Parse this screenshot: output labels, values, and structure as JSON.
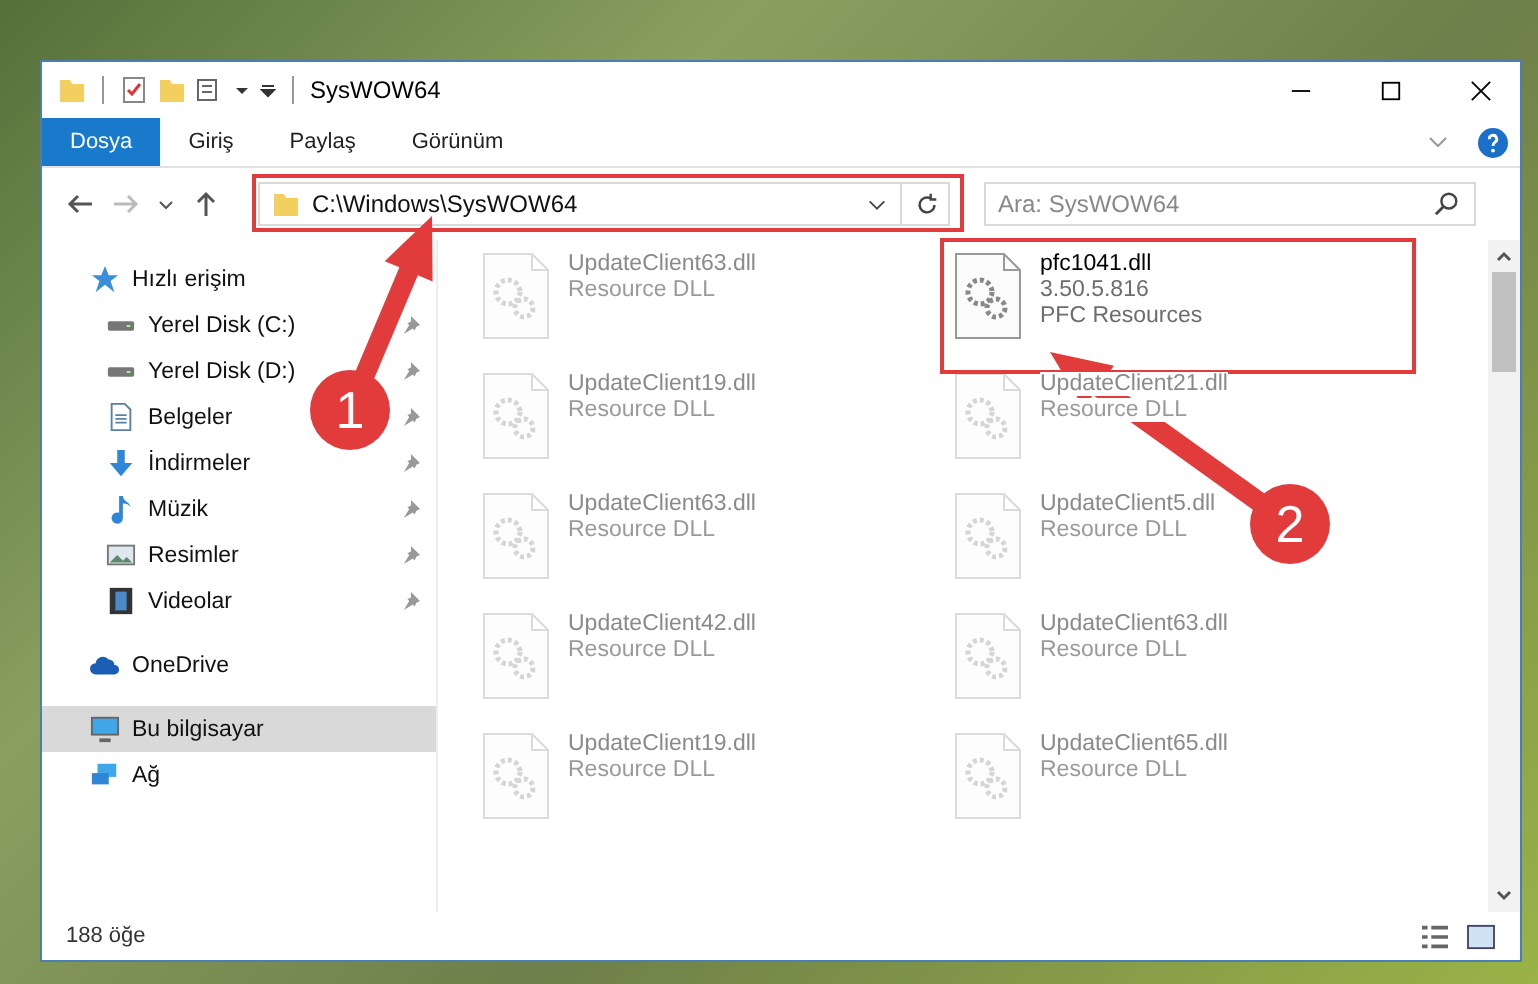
{
  "window": {
    "title": "SysWOW64"
  },
  "ribbon_tabs": [
    {
      "label": "Dosya",
      "selected": true
    },
    {
      "label": "Giriş",
      "selected": false
    },
    {
      "label": "Paylaş",
      "selected": false
    },
    {
      "label": "Görünüm",
      "selected": false
    }
  ],
  "address_bar": {
    "path": "C:\\Windows\\SysWOW64"
  },
  "search": {
    "placeholder": "Ara: SysWOW64"
  },
  "sidebar": {
    "items": [
      {
        "label": "Hızlı erişim",
        "kind": "star",
        "selected": false,
        "children": [
          {
            "label": "Yerel Disk (C:)",
            "kind": "drive",
            "selected": false
          },
          {
            "label": "Yerel Disk (D:)",
            "kind": "drive",
            "selected": false
          },
          {
            "label": "Belgeler",
            "kind": "document",
            "selected": false
          },
          {
            "label": "İndirmeler",
            "kind": "download",
            "selected": false
          },
          {
            "label": "Müzik",
            "kind": "music",
            "selected": false
          },
          {
            "label": "Resimler",
            "kind": "picture",
            "selected": false
          },
          {
            "label": "Videolar",
            "kind": "video",
            "selected": false
          }
        ]
      },
      {
        "label": "OneDrive",
        "kind": "cloud",
        "selected": false
      },
      {
        "label": "Bu bilgisayar",
        "kind": "computer",
        "selected": true
      },
      {
        "label": "Ağ",
        "kind": "network",
        "selected": false
      }
    ]
  },
  "files": [
    {
      "name": "UpdateClient63.dll",
      "details": [
        "Resource DLL"
      ],
      "dimmed": true
    },
    {
      "name": "pfc1041.dll",
      "details": [
        "3.50.5.816",
        "PFC Resources"
      ],
      "dimmed": false
    },
    {
      "name": "UpdateClient19.dll",
      "details": [
        "Resource DLL"
      ],
      "dimmed": true
    },
    {
      "name": "UpdateClient21.dll",
      "details": [
        "Resource DLL"
      ],
      "dimmed": true
    },
    {
      "name": "UpdateClient63.dll",
      "details": [
        "Resource DLL"
      ],
      "dimmed": true
    },
    {
      "name": "UpdateClient5.dll",
      "details": [
        "Resource DLL"
      ],
      "dimmed": true
    },
    {
      "name": "UpdateClient42.dll",
      "details": [
        "Resource DLL"
      ],
      "dimmed": true
    },
    {
      "name": "UpdateClient63.dll",
      "details": [
        "Resource DLL"
      ],
      "dimmed": true
    },
    {
      "name": "UpdateClient19.dll",
      "details": [
        "Resource DLL"
      ],
      "dimmed": true
    },
    {
      "name": "UpdateClient65.dll",
      "details": [
        "Resource DLL"
      ],
      "dimmed": true
    }
  ],
  "status_bar": {
    "count": "188 öğe"
  },
  "annotations": [
    {
      "number": "1"
    },
    {
      "number": "2"
    }
  ]
}
